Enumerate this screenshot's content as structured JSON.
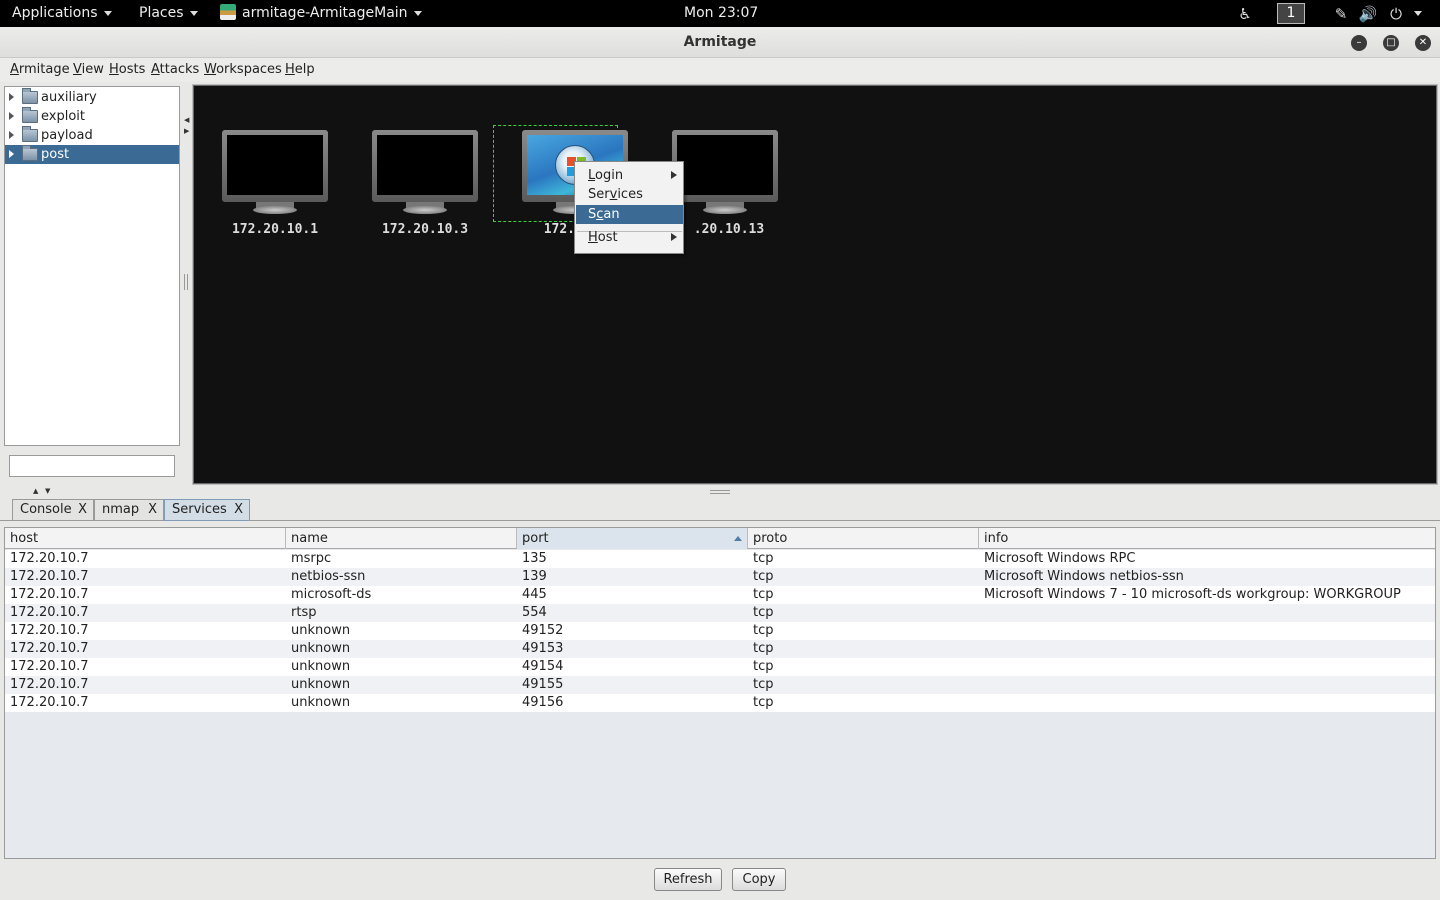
{
  "topbar": {
    "applications": "Applications",
    "places": "Places",
    "window_name": "armitage-ArmitageMain",
    "clock": "Mon 23:07",
    "workspace": "1"
  },
  "window": {
    "title": "Armitage"
  },
  "menubar": {
    "items": [
      {
        "mnemonic": "A",
        "rest": "rmitage"
      },
      {
        "mnemonic": "V",
        "rest": "iew"
      },
      {
        "mnemonic": "H",
        "rest": "osts"
      },
      {
        "mnemonic": "A",
        "rest": "ttacks"
      },
      {
        "mnemonic": "W",
        "rest": "orkspaces"
      },
      {
        "mnemonic": "H",
        "rest": "elp"
      }
    ]
  },
  "modules": {
    "items": [
      {
        "label": "auxiliary"
      },
      {
        "label": "exploit"
      },
      {
        "label": "payload"
      },
      {
        "label": "post"
      }
    ],
    "search_value": ""
  },
  "graph": {
    "hosts": [
      {
        "label": "172.20.10.1",
        "os": "unknown"
      },
      {
        "label": "172.20.10.3",
        "os": "unknown"
      },
      {
        "label": "172.20.1",
        "os": "windows"
      },
      {
        "label": ".20.10.13",
        "os": "unknown"
      }
    ]
  },
  "context_menu": {
    "items": [
      {
        "pre": "",
        "mnemonic": "L",
        "post": "ogin",
        "submenu": true
      },
      {
        "pre": "Ser",
        "mnemonic": "v",
        "post": "ices",
        "submenu": false
      },
      {
        "pre": "S",
        "mnemonic": "c",
        "post": "an",
        "submenu": false
      },
      {
        "pre": "",
        "mnemonic": "H",
        "post": "ost",
        "submenu": true
      }
    ]
  },
  "tabs": [
    {
      "label": "Console",
      "close": "X"
    },
    {
      "label": "nmap",
      "close": "X"
    },
    {
      "label": "Services",
      "close": "X"
    }
  ],
  "services": {
    "columns": [
      "host",
      "name",
      "port",
      "proto",
      "info"
    ],
    "rows": [
      [
        "172.20.10.7",
        "msrpc",
        "135",
        "tcp",
        "Microsoft Windows RPC"
      ],
      [
        "172.20.10.7",
        "netbios-ssn",
        "139",
        "tcp",
        "Microsoft Windows netbios-ssn"
      ],
      [
        "172.20.10.7",
        "microsoft-ds",
        "445",
        "tcp",
        "Microsoft Windows 7 - 10 microsoft-ds workgroup: WORKGROUP"
      ],
      [
        "172.20.10.7",
        "rtsp",
        "554",
        "tcp",
        ""
      ],
      [
        "172.20.10.7",
        "unknown",
        "49152",
        "tcp",
        ""
      ],
      [
        "172.20.10.7",
        "unknown",
        "49153",
        "tcp",
        ""
      ],
      [
        "172.20.10.7",
        "unknown",
        "49154",
        "tcp",
        ""
      ],
      [
        "172.20.10.7",
        "unknown",
        "49155",
        "tcp",
        ""
      ],
      [
        "172.20.10.7",
        "unknown",
        "49156",
        "tcp",
        ""
      ]
    ]
  },
  "buttons": {
    "refresh": "Refresh",
    "copy": "Copy"
  }
}
